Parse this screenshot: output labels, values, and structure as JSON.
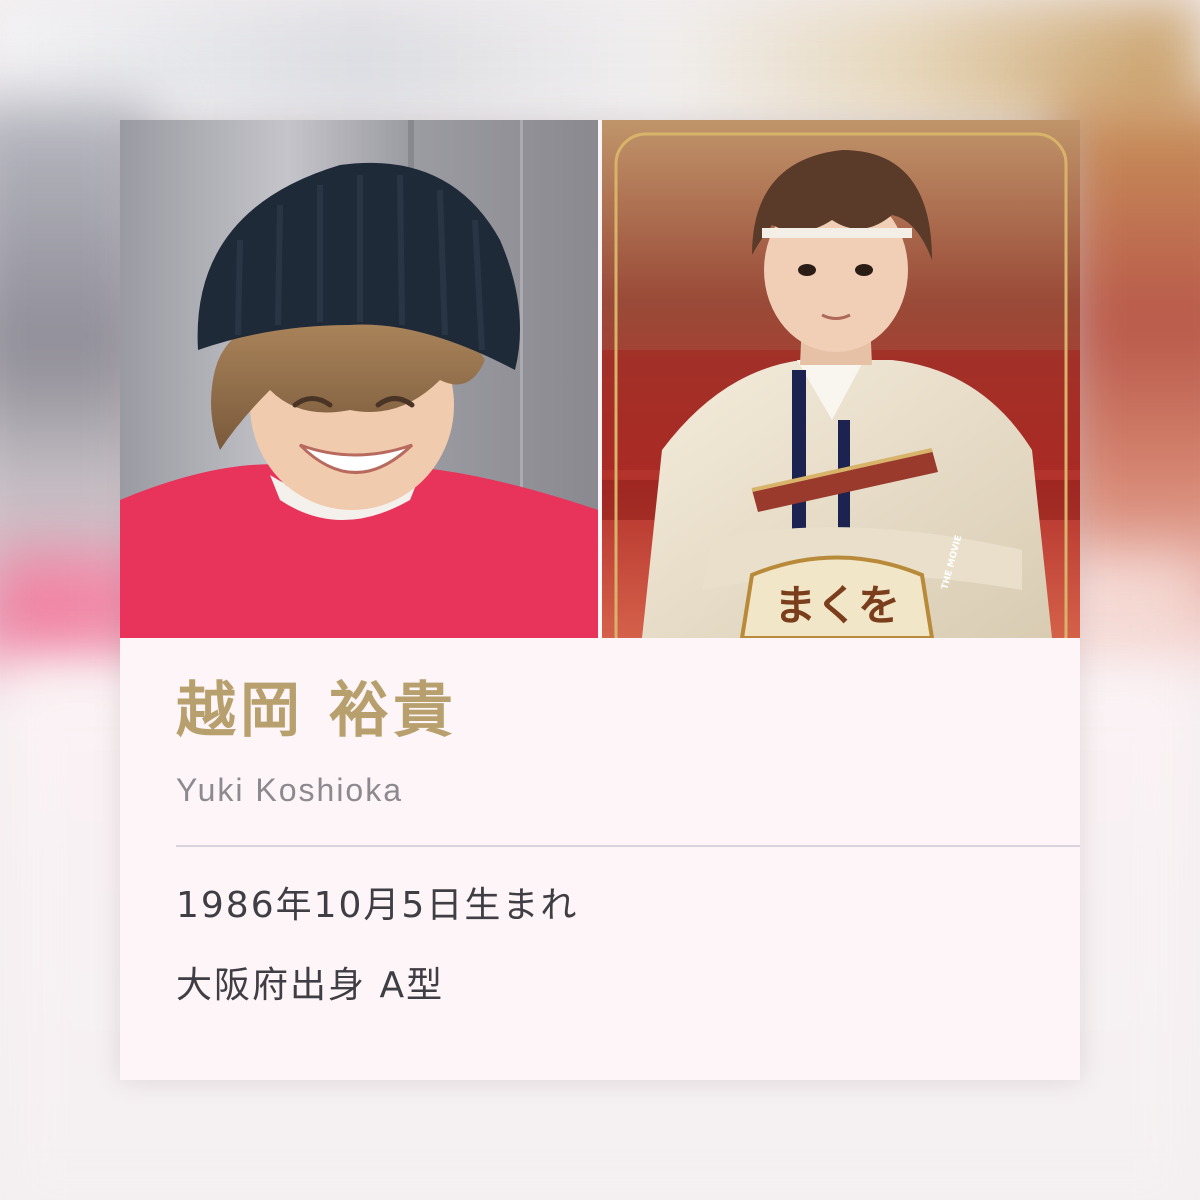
{
  "profile": {
    "name_jp": "越岡 裕貴",
    "name_en": "Yuki Koshioka",
    "birth": "1986年10月5日生まれ",
    "origin": "大阪府出身 A型"
  },
  "photos": {
    "left": {
      "subject": "smiling-man-beanie-red-sweater"
    },
    "right": {
      "subject": "man-in-stage-costume",
      "logo_text": "まくを",
      "logo_subtext": "THE MOVIE"
    }
  },
  "colors": {
    "name_gold": "#b8a06e",
    "subtitle_gray": "#8d8a8f",
    "body_text": "#3f3e44",
    "card_bg": "#fdf5f7",
    "sweater_red": "#e8345a",
    "costume_red": "#b5322c"
  }
}
